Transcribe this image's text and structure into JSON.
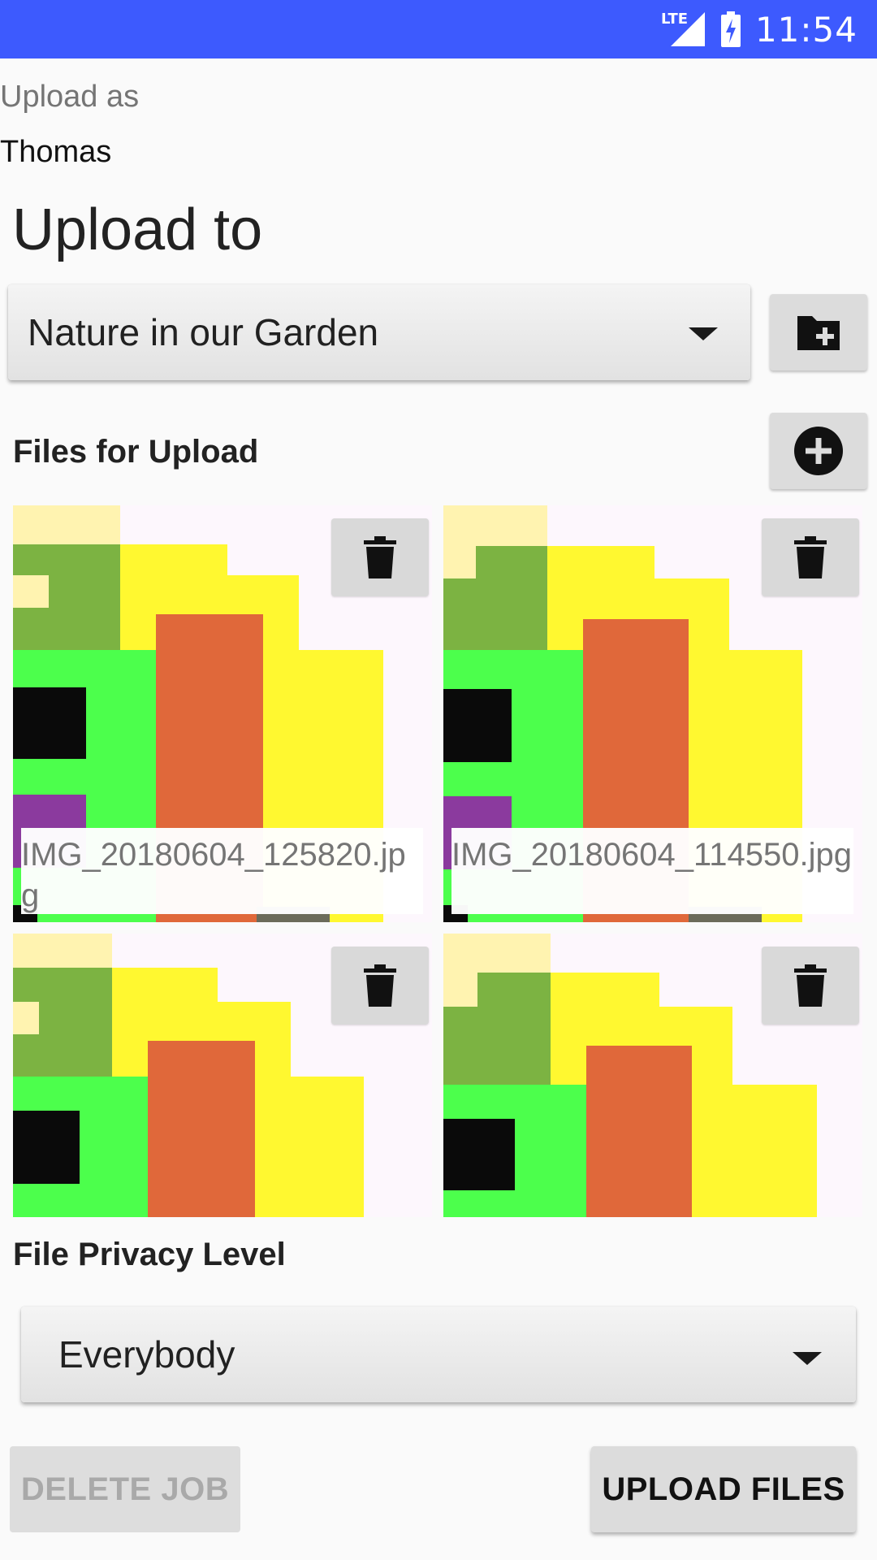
{
  "status_bar": {
    "network": "LTE",
    "time": "11:54"
  },
  "upload_as": {
    "label": "Upload as",
    "user": "Thomas"
  },
  "upload_to": {
    "heading": "Upload to",
    "gallery": "Nature in our Garden"
  },
  "files_section": {
    "heading": "Files for Upload"
  },
  "files": [
    {
      "filename": "IMG_20180604_125820.jpg"
    },
    {
      "filename": "IMG_20180604_114550.jpg"
    },
    {
      "filename": ""
    },
    {
      "filename": ""
    }
  ],
  "privacy": {
    "heading": "File Privacy Level",
    "value": "Everybody"
  },
  "actions": {
    "delete_job": "DELETE JOB",
    "upload_files": "UPLOAD FILES"
  },
  "colors": {
    "status_bar": "#3d5afe",
    "tile_bg": "#fdf7fd",
    "cream": "#fff3b0",
    "olive": "#7cb342",
    "yellow": "#fff830",
    "green": "#4cff4c",
    "orange": "#e0683a",
    "black": "#0a0a0a",
    "purple": "#8b3a9e"
  }
}
